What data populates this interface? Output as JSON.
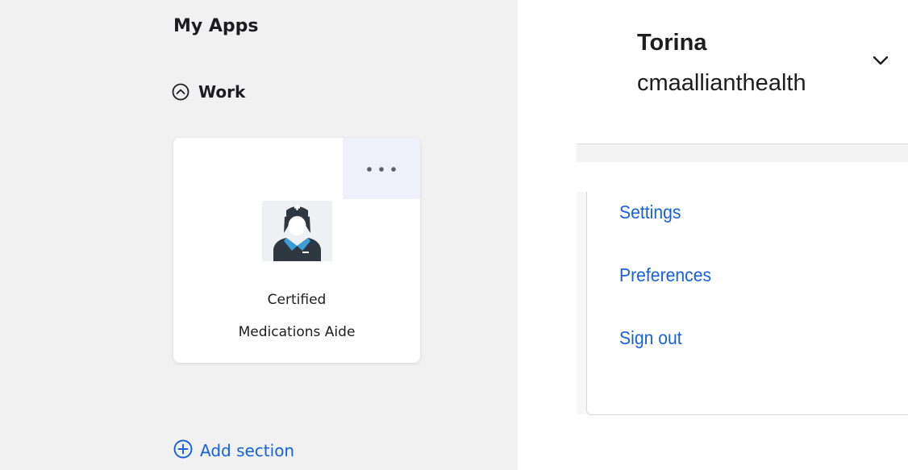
{
  "left_panel": {
    "title": "My Apps",
    "section": {
      "label": "Work",
      "icon": "chevron-up-circle-icon"
    },
    "app_tile": {
      "name_line1": "Certified",
      "name_line2": "Medications Aide",
      "logo_icon": "nurse-icon",
      "menu_icon": "more-horizontal-icon"
    },
    "add_section": {
      "label": "Add section",
      "icon": "plus-circle-icon"
    }
  },
  "user_menu": {
    "name": "Torina",
    "org": "cmaallianthealth",
    "toggle_icon": "chevron-down-icon",
    "items": [
      {
        "label": "Settings"
      },
      {
        "label": "Preferences"
      },
      {
        "label": "Sign out"
      }
    ]
  },
  "colors": {
    "link": "#1662dd",
    "text": "#1d1d21",
    "panel_bg": "#f1f1f1",
    "tile_menu_bg": "#eef0fb"
  }
}
